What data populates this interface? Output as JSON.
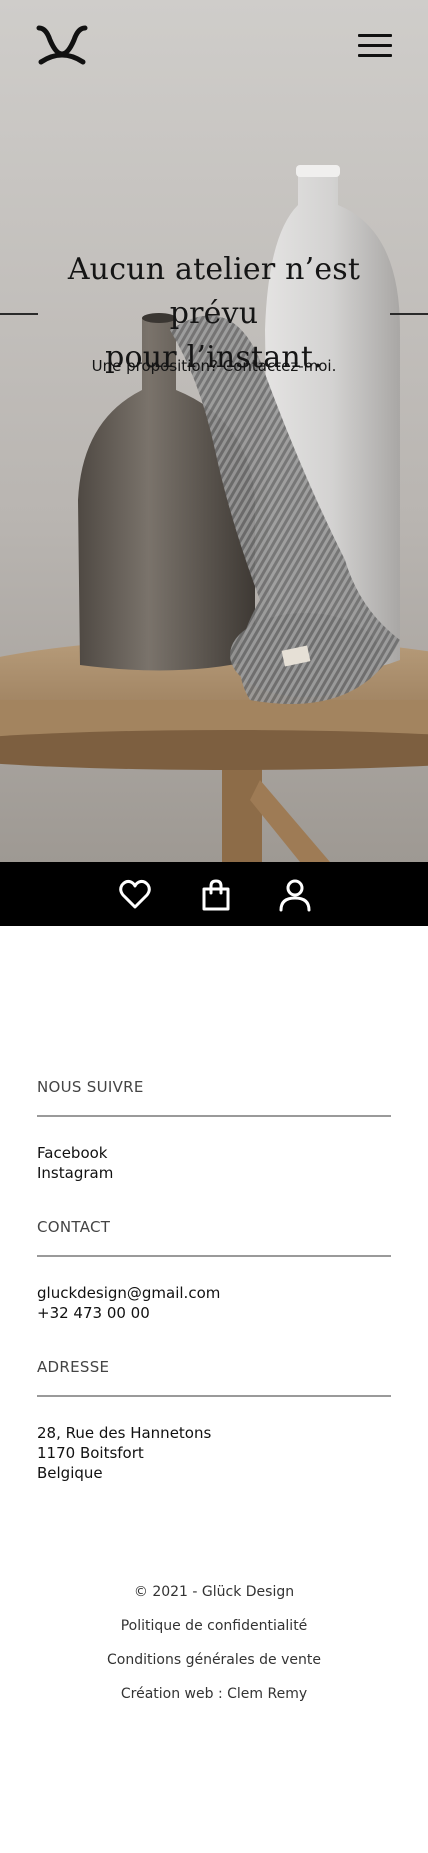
{
  "header": {
    "logo": "gluck-logo",
    "menu_icon": "hamburger-icon"
  },
  "hero": {
    "title_line1": "Aucun atelier n’est prévu",
    "title_line2": "pour l’instant.",
    "subtitle": "Une proposition? Contactez-moi."
  },
  "icon_bar": {
    "items": [
      {
        "icon": "heart-icon"
      },
      {
        "icon": "shopping-bag-icon"
      },
      {
        "icon": "user-icon"
      }
    ]
  },
  "footer": {
    "follow": {
      "heading": "NOUS SUIVRE",
      "links": [
        "Facebook",
        "Instagram"
      ]
    },
    "contact": {
      "heading": "CONTACT",
      "email": "gluckdesign@gmail.com",
      "phone": "+32 473 00 00"
    },
    "address": {
      "heading": "ADRESSE",
      "line1": "28, Rue des Hannetons",
      "line2": "1170 Boitsfort",
      "line3": "Belgique"
    },
    "legal": {
      "copyright": "© 2021 - Glück Design",
      "privacy": "Politique de confidentialité",
      "terms": "Conditions générales de vente",
      "credit": "Création web : Clem Remy"
    }
  },
  "colors": {
    "icon_bar_bg": "#000000",
    "rule": "#9a9a9a",
    "text": "#111111"
  }
}
